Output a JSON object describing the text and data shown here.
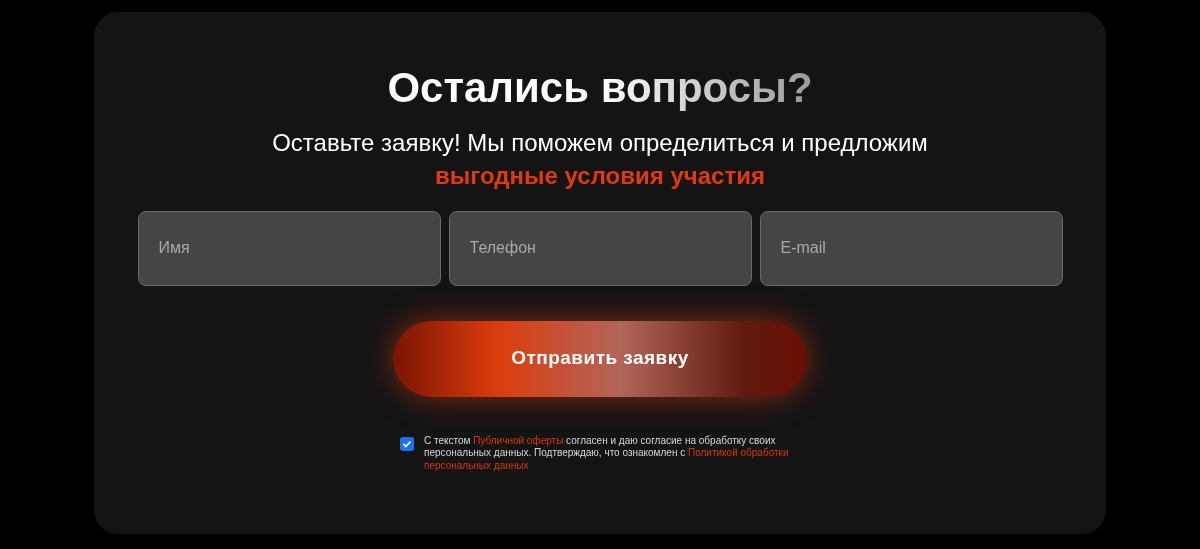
{
  "heading": "Остались вопросы?",
  "subtitle": "Оставьте заявку! Мы поможем определиться и предложим",
  "subtitle_accent": "выгодные условия участия",
  "fields": [
    {
      "placeholder": "Имя"
    },
    {
      "placeholder": "Телефон"
    },
    {
      "placeholder": "E-mail"
    }
  ],
  "submit": "Отправить заявку",
  "consent": {
    "checked": true,
    "parts": [
      {
        "kind": "text",
        "text": "С текстом"
      },
      {
        "kind": "link",
        "text": "Публичной оферты"
      },
      {
        "kind": "text",
        "text": "согласен и даю согласие на обработку своих персональных данных. Подтверждаю, что ознакомлен с"
      },
      {
        "kind": "link",
        "text": "Политикой обработки"
      },
      {
        "kind": "link",
        "text": "персональных данных"
      }
    ]
  }
}
